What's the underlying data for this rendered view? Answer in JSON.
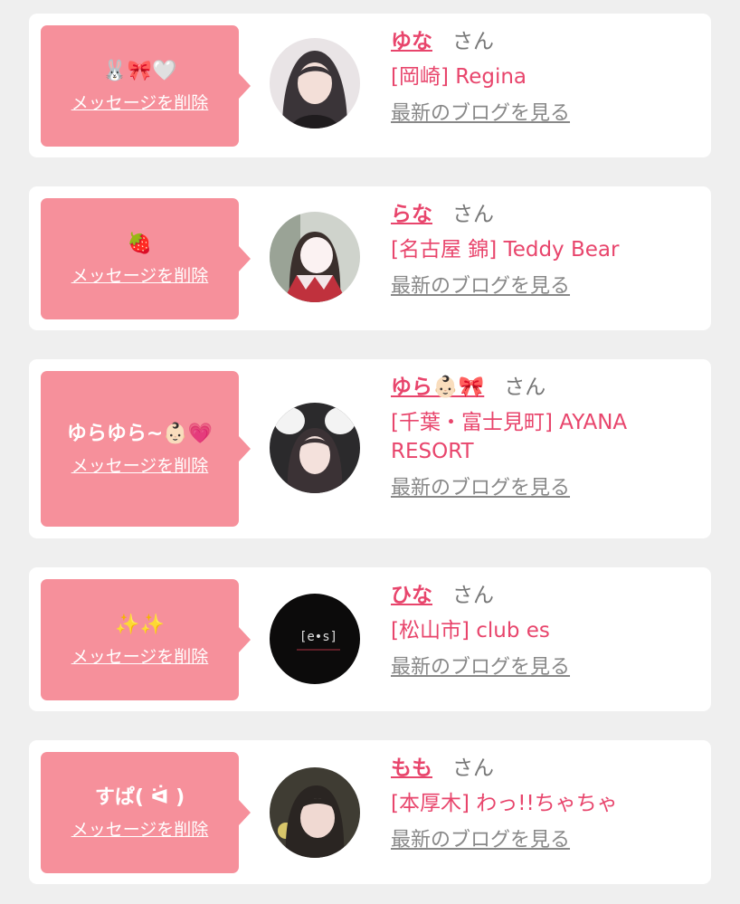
{
  "colors": {
    "background": "#efefef",
    "card": "#ffffff",
    "bubble": "#f6909b",
    "accent": "#e8456c",
    "muted": "#888888"
  },
  "delete_label": "メッセージを削除",
  "honorific": "さん",
  "blog_label": "最新のブログを見る",
  "favorites": [
    {
      "message": "🐰🎀🤍",
      "name": "ゆな",
      "shop": "[岡崎] Regina",
      "avatar": "avatar-photo"
    },
    {
      "message": "🍓",
      "name": "らな",
      "shop": "[名古屋 錦] Teddy Bear",
      "avatar": "avatar-photo"
    },
    {
      "message": "ゆらゆら~👶🏻💗",
      "name": "ゆら👶🏻🎀",
      "shop": "[千葉・富士見町] AYANA RESORT",
      "avatar": "avatar-photo"
    },
    {
      "message": "✨✨",
      "name": "ひな",
      "shop": "[松山市] club es",
      "avatar": "avatar-logo",
      "logo_text": "[e•s]"
    },
    {
      "message": "すぱ( ᐛ )",
      "name": "もも",
      "shop": "[本厚木] わっ!!ちゃちゃ",
      "avatar": "avatar-photo"
    }
  ]
}
